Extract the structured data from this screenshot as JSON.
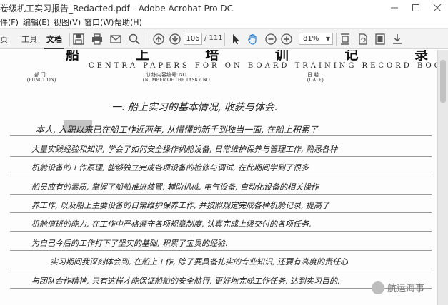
{
  "window": {
    "title": "卷级机工实习报告_Redacted.pdf - Adobe Acrobat Pro DC"
  },
  "menu": [
    "件(F)",
    "编辑(E)",
    "视图(V)",
    "窗口(W)",
    "帮助(H)"
  ],
  "tabs": [
    {
      "label": "页",
      "active": false
    },
    {
      "label": "工具",
      "active": false
    },
    {
      "label": "文档",
      "active": true
    }
  ],
  "toolbar": {
    "page_current": "106",
    "page_total": "/ 111",
    "zoom": "81%"
  },
  "document": {
    "header_title": "船 上 培 训 记 录 簿 附 页",
    "header_subtitle": "CENTRA PAPERS FOR ON BOARD TRAINING RECORD BOOK",
    "labels": {
      "subject": "部 门:",
      "function": "(FUNCTION)",
      "task_no": "训练内容编号: NO.",
      "task_no_en": "(NUMBER OF THE TASK): NO.",
      "date": "日 期:",
      "date_en": "(DATE):"
    },
    "heading": "一. 船上实习的基本情况, 收获与体会.",
    "lines": [
      "本人, 入职以来已在船工作近两年, 从懵懂的新手到独当一面, 在船上积累了",
      "大量实践经验和知识, 学会了如何安全操作机舱设备, 日常维护保养与管理工作, 熟悉各种",
      "机舱设备的工作原理, 能够独立完成各项设备的检修与调试, 在此期间学到了很多",
      "船员应有的素质, 掌握了船舶推进装置, 辅助机械, 电气设备, 自动化设备的相关操作",
      "养工作, 以及船上主要设备的日常维护保养工作, 并按照规定完成各种机舱记录, 提高了",
      "机舱值班的能力, 在工作中严格遵守各项规章制度, 认真完成上级交付的各项任务,",
      "为自己今后的工作打下了坚实的基础, 积累了宝贵的经验.",
      "实习期间我深刻体会到, 在船上工作, 除了要具备扎实的专业知识, 还要有高度的责任心",
      "与团队合作精神, 只有这样才能保证船舶的安全航行, 更好地完成工作任务, 达到实习目的."
    ],
    "watermark": "航运海事"
  }
}
